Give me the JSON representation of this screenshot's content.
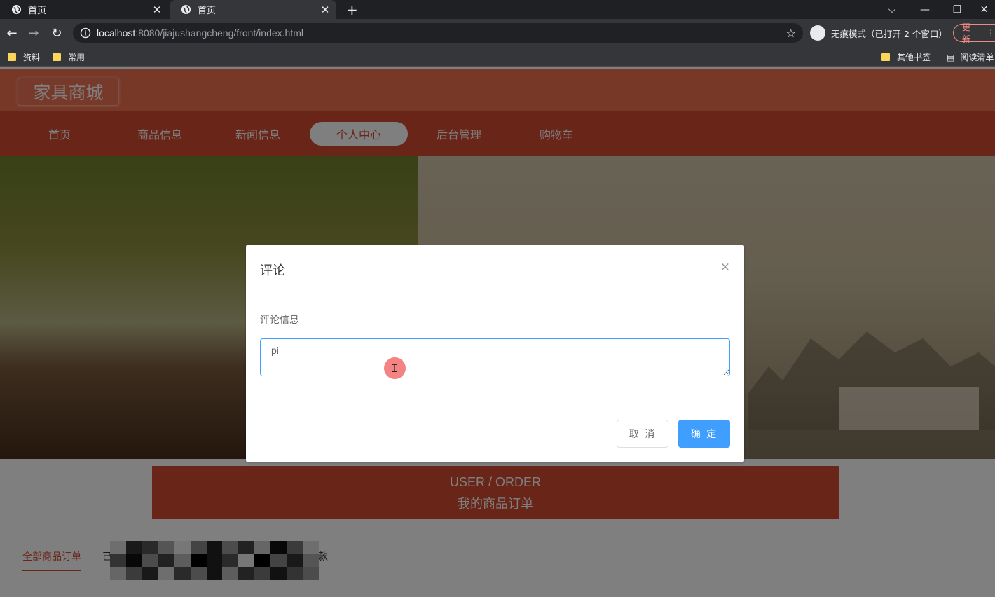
{
  "browser": {
    "tabs": [
      {
        "title": "首页",
        "active": false
      },
      {
        "title": "首页",
        "active": true
      }
    ],
    "new_tab": "+",
    "url_host": "localhost",
    "url_rest": ":8080/jiajushangcheng/front/index.html",
    "incognito_label": "无痕模式（已打开 2 个窗口）",
    "update_label": "更新",
    "bookmarks_left": [
      "资料",
      "常用"
    ],
    "bookmarks_right": [
      "其他书签",
      "阅读清单"
    ]
  },
  "site": {
    "logo": "家具商城",
    "nav": [
      "首页",
      "商品信息",
      "新闻信息",
      "个人中心",
      "后台管理",
      "购物车"
    ],
    "nav_active_index": 3
  },
  "section": {
    "title_en": "USER / ORDER",
    "title_cn": "我的商品订单"
  },
  "order_tabs": {
    "first": "全部商品订单",
    "partial_start": "已",
    "partial_end": "款"
  },
  "dialog": {
    "title": "评论",
    "close_icon": "×",
    "field_label": "评论信息",
    "field_value": "pi",
    "cancel_label": "取 消",
    "confirm_label": "确 定"
  },
  "colors": {
    "header_orange": "#f0704e",
    "nav_red": "#d24b2f",
    "primary_blue": "#409eff"
  }
}
